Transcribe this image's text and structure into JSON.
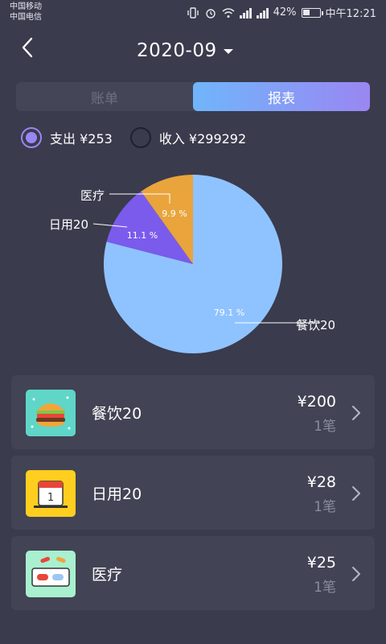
{
  "status_bar": {
    "carrier_1": "中国移动",
    "carrier_2": "中国电信",
    "battery": "42%",
    "battery_level": 0.42,
    "time": "中午12:21"
  },
  "header": {
    "month": "2020-09"
  },
  "tabs": [
    {
      "label": "账单",
      "active": false
    },
    {
      "label": "报表",
      "active": true
    }
  ],
  "filters": {
    "expense_label": "支出 ¥253",
    "expense_selected": true,
    "income_label": "收入 ¥299292",
    "income_selected": false
  },
  "chart_data": {
    "type": "pie",
    "slices": [
      {
        "label": "餐饮20",
        "percent_label": "79.1 %",
        "value": 79.1,
        "color": "#8fc3ff"
      },
      {
        "label": "日用20",
        "percent_label": "11.1 %",
        "value": 11.1,
        "color": "#7a5bec"
      },
      {
        "label": "医疗",
        "percent_label": "9.9 %",
        "value": 9.9,
        "color": "#e9a43c"
      }
    ]
  },
  "categories": [
    {
      "name": "餐饮20",
      "amount": "¥200",
      "count": "1笔",
      "icon": "burger-icon",
      "icon_bg": "#5fd6c8"
    },
    {
      "name": "日用20",
      "amount": "¥28",
      "count": "1笔",
      "icon": "calendar-icon",
      "icon_bg": "#ffce1f"
    },
    {
      "name": "医疗",
      "amount": "¥25",
      "count": "1笔",
      "icon": "pill-icon",
      "icon_bg": "#a8f0cf"
    }
  ],
  "colors": {
    "background": "#3a3b4d",
    "card": "#424354",
    "accent_start": "#6fb6fb",
    "accent_end": "#9a86f2"
  }
}
